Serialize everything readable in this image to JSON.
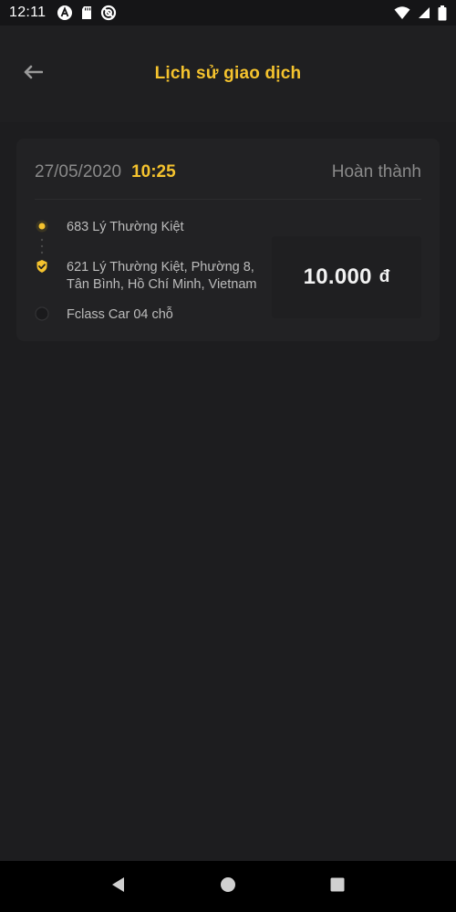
{
  "status_bar": {
    "time": "12:11",
    "left_icons": [
      "android-a-icon",
      "sd-card-icon",
      "no-disturb-icon"
    ],
    "right_icons": [
      "wifi-icon",
      "cell-signal-icon",
      "battery-icon"
    ]
  },
  "header": {
    "title": "Lịch sử giao dịch",
    "back_icon": "arrow-left-icon"
  },
  "trip": {
    "date": "27/05/2020",
    "time": "10:25",
    "status": "Hoàn thành",
    "pickup": "683 Lý Thường Kiệt",
    "dropoff_line1": "621 Lý Thường Kiệt, Phường 8,",
    "dropoff_line2": "Tân Bình, Hồ Chí Minh, Vietnam",
    "vehicle": "Fclass Car 04 chỗ",
    "price": "10.000",
    "currency": "đ"
  },
  "nav": {
    "back": "nav-back-icon",
    "home": "nav-home-icon",
    "recents": "nav-recents-icon"
  },
  "colors": {
    "accent": "#f5c32e",
    "background": "#1d1d1f",
    "card": "#222224",
    "muted_text": "#8a8a8a"
  }
}
